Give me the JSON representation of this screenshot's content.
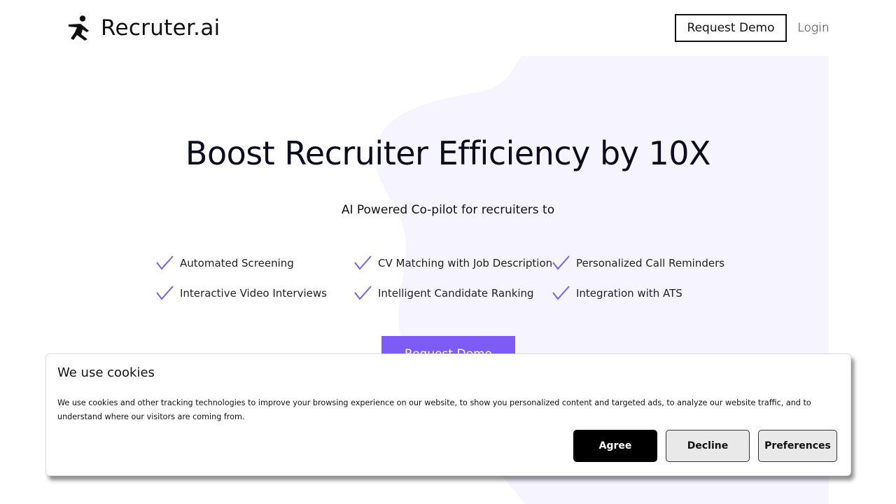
{
  "header": {
    "brand": "Recruter.ai",
    "request_demo_label": "Request Demo",
    "login_label": "Login"
  },
  "hero": {
    "title": "Boost Recruiter Efficiency by 10X",
    "subtitle": "AI Powered Co-pilot for recruiters to",
    "features": [
      "Automated Screening",
      "CV Matching with Job Description",
      "Personalized Call Reminders",
      "Interactive Video Interviews",
      "Intelligent Candidate Ranking",
      "Integration with ATS"
    ],
    "cta_label": "Request Demo"
  },
  "cookie_banner": {
    "title": "We use cookies",
    "text": "We use cookies and other tracking technologies to improve your browsing experience on our website, to show you personalized content and targeted ads, to analyze our website traffic, and to understand where our visitors are coming from.",
    "agree_label": "Agree",
    "decline_label": "Decline",
    "preferences_label": "Preferences"
  },
  "colors": {
    "accent": "#7c5cf5",
    "check": "#7b61f0",
    "hero_background": "#f6f5ff",
    "text": "#0d0d1f"
  },
  "icons": {
    "logo": "running-figure-icon",
    "feature": "check-icon"
  }
}
